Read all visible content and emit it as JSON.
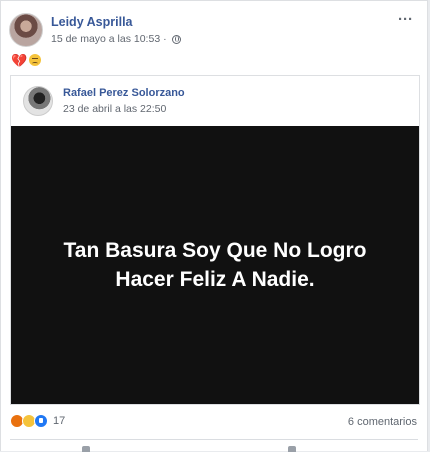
{
  "post": {
    "author": "Leidy Asprilla",
    "date": "15 de mayo a las 10:53",
    "more": "···",
    "status_icons": [
      "broken-heart-icon",
      "sad-face-icon"
    ],
    "heart_glyph": "💔"
  },
  "shared": {
    "author": "Rafael Perez Solorzano",
    "date": "23 de abril a las 22:50",
    "quote": "Tan Basura Soy Que No Logro Hacer Feliz A Nadie."
  },
  "footer": {
    "reaction_icons": [
      "angry-icon",
      "sad-icon",
      "like-icon"
    ],
    "reaction_count": "17",
    "comments": "6 comentarios"
  },
  "colors": {
    "link": "#385898",
    "meta": "#616770",
    "image_bg": "#111111"
  }
}
